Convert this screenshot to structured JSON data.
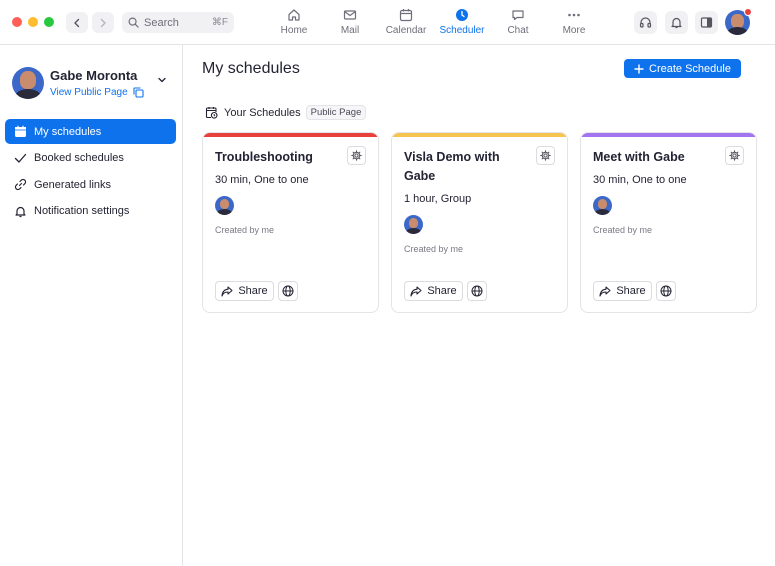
{
  "topbar": {
    "search": {
      "placeholder": "Search",
      "shortcut": "⌘F"
    },
    "nav": [
      {
        "label": "Home",
        "icon": "home-icon"
      },
      {
        "label": "Mail",
        "icon": "mail-icon"
      },
      {
        "label": "Calendar",
        "icon": "calendar-icon"
      },
      {
        "label": "Scheduler",
        "icon": "clock-icon",
        "active": true
      },
      {
        "label": "Chat",
        "icon": "chat-icon"
      },
      {
        "label": "More",
        "icon": "more-icon"
      }
    ],
    "accent_color": "#0e72ed",
    "notification_dot_color": "#e8413c"
  },
  "sidebar": {
    "user_name": "Gabe Moronta",
    "view_public_page": "View Public Page",
    "items": [
      {
        "label": "My schedules",
        "icon": "calendar-icon",
        "active": true
      },
      {
        "label": "Booked schedules",
        "icon": "checkmark-icon"
      },
      {
        "label": "Generated links",
        "icon": "link-icon"
      },
      {
        "label": "Notification settings",
        "icon": "bell-icon"
      }
    ]
  },
  "main": {
    "title": "My schedules",
    "create_button": "Create Schedule",
    "section_title": "Your Schedules",
    "section_tag": "Public Page",
    "cards": [
      {
        "title": "Troubleshooting",
        "meta": "30 min, One to one",
        "created": "Created by me",
        "share": "Share",
        "stripe_color": "#e8413c"
      },
      {
        "title": "Visla Demo with Gabe",
        "meta": "1 hour, Group",
        "created": "Created by me",
        "share": "Share",
        "stripe_color": "#f5c451"
      },
      {
        "title": "Meet with Gabe",
        "meta": "30 min, One to one",
        "created": "Created by me",
        "share": "Share",
        "stripe_color": "#a374f0"
      }
    ]
  }
}
